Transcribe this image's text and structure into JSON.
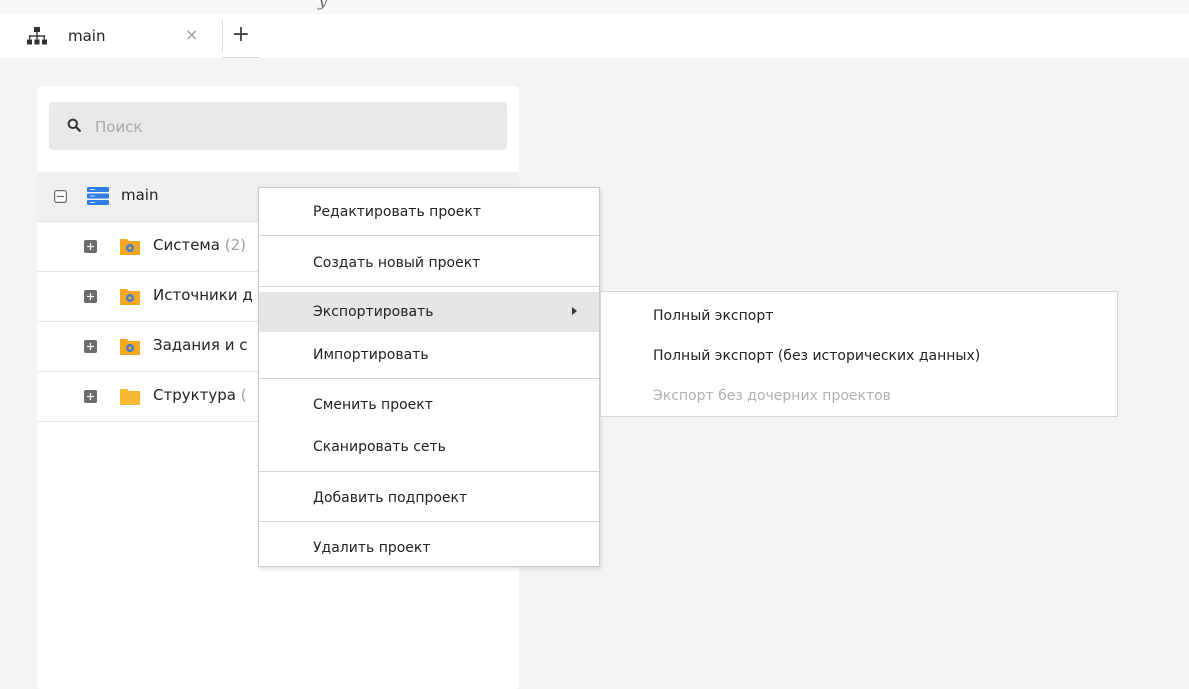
{
  "header_strip": {
    "text": "y"
  },
  "tab": {
    "title": "main",
    "close_glyph": "×",
    "add_glyph": "+",
    "icon": "network-tree-icon"
  },
  "search": {
    "placeholder": "Поиск",
    "value": ""
  },
  "tree": {
    "root": {
      "label": "main",
      "icon": "server-stack-icon",
      "toggle": "collapse"
    },
    "items": [
      {
        "label": "Система",
        "count": "(2)",
        "icon": "folder-gear-icon"
      },
      {
        "label": "Источники д",
        "count": "",
        "icon": "folder-gear-icon"
      },
      {
        "label": "Задания и с",
        "count": "",
        "icon": "folder-gear-icon"
      },
      {
        "label": "Структура",
        "count": "(",
        "icon": "folder-icon"
      }
    ]
  },
  "context_menu": {
    "items": [
      {
        "label": "Редактировать проект"
      },
      {
        "label": "Создать новый проект"
      },
      {
        "label": "Экспортировать",
        "has_submenu": true,
        "active": true
      },
      {
        "label": "Импортировать"
      },
      {
        "label": "Сменить проект"
      },
      {
        "label": "Сканировать сеть"
      },
      {
        "label": "Добавить подпроект"
      },
      {
        "label": "Удалить проект"
      }
    ]
  },
  "export_submenu": {
    "items": [
      {
        "label": "Полный экспорт",
        "enabled": true
      },
      {
        "label": "Полный экспорт (без исторических данных)",
        "enabled": true
      },
      {
        "label": "Экспорт без дочерних проектов",
        "enabled": false
      }
    ]
  },
  "colors": {
    "folder_gear": "#f5a623",
    "folder_plain": "#f7b733",
    "gear_blue": "#3d7fcf",
    "server_blue": "#2f7de1",
    "toggle_gray": "#6b6b6b"
  }
}
